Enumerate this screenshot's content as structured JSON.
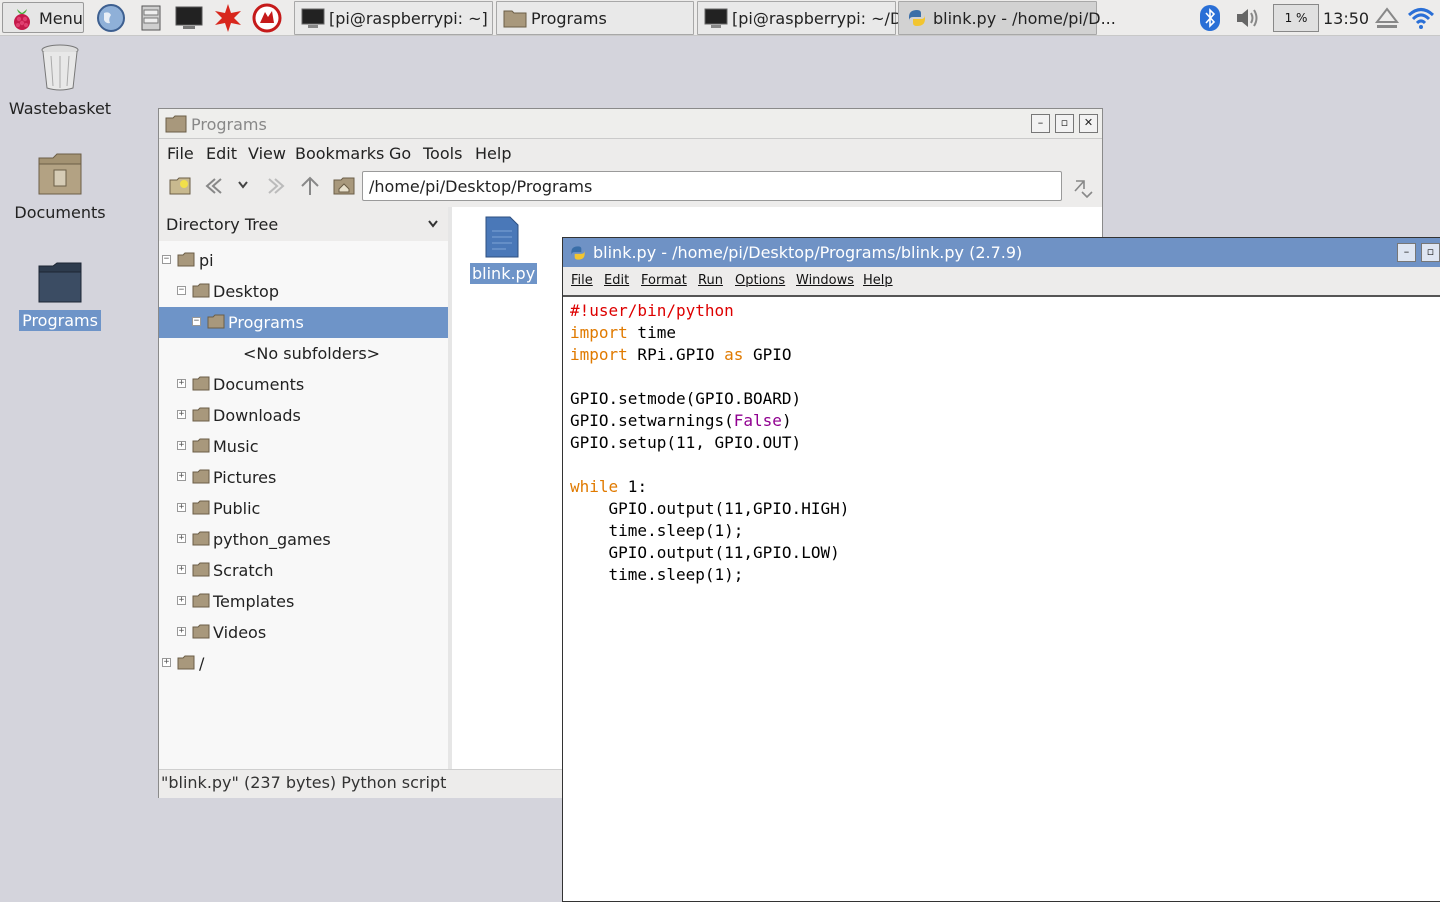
{
  "taskbar": {
    "menu_label": "Menu",
    "tasks": [
      {
        "label": "[pi@raspberrypi: ~]"
      },
      {
        "label": "Programs"
      },
      {
        "label": "[pi@raspberrypi: ~/D..."
      },
      {
        "label": "blink.py - /home/pi/D..."
      }
    ],
    "cpu": "1 %",
    "clock": "13:50"
  },
  "desktop": {
    "icons": [
      {
        "label": "Wastebasket"
      },
      {
        "label": "Documents"
      },
      {
        "label": "Programs"
      }
    ]
  },
  "file_manager": {
    "title": "Programs",
    "menu": [
      "File",
      "Edit",
      "View",
      "Bookmarks",
      "Go",
      "Tools",
      "Help"
    ],
    "path": "/home/pi/Desktop/Programs",
    "sidebar_mode": "Directory Tree",
    "tree": [
      {
        "label": "pi"
      },
      {
        "label": "Desktop"
      },
      {
        "label": "Programs"
      },
      {
        "label": "<No subfolders>"
      },
      {
        "label": "Documents"
      },
      {
        "label": "Downloads"
      },
      {
        "label": "Music"
      },
      {
        "label": "Pictures"
      },
      {
        "label": "Public"
      },
      {
        "label": "python_games"
      },
      {
        "label": "Scratch"
      },
      {
        "label": "Templates"
      },
      {
        "label": "Videos"
      },
      {
        "label": "/"
      }
    ],
    "file": "blink.py",
    "status": "\"blink.py\" (237 bytes) Python script"
  },
  "idle": {
    "title": "blink.py - /home/pi/Desktop/Programs/blink.py (2.7.9)",
    "menu": [
      "File",
      "Edit",
      "Format",
      "Run",
      "Options",
      "Windows",
      "Help"
    ],
    "code": {
      "l1": "#!user/bin/python",
      "l2_kw": "import",
      "l2_rest": " time",
      "l3_kw": "import",
      "l3_mid": " RPi.GPIO ",
      "l3_kw2": "as",
      "l3_rest": " GPIO",
      "l5": "GPIO.setmode(GPIO.BOARD)",
      "l6_a": "GPIO.setwarnings(",
      "l6_b": "False",
      "l6_c": ")",
      "l7": "GPIO.setup(11, GPIO.OUT)",
      "l9_kw": "while",
      "l9_rest": " 1:",
      "l10": "    GPIO.output(11,GPIO.HIGH)",
      "l11": "    time.sleep(1);",
      "l12": "    GPIO.output(11,GPIO.LOW)",
      "l13": "    time.sleep(1);"
    }
  },
  "colors": {
    "selection": "#6e94c8",
    "keyword": "#e07a00",
    "comment": "#dd0000",
    "builtin": "#900090"
  }
}
